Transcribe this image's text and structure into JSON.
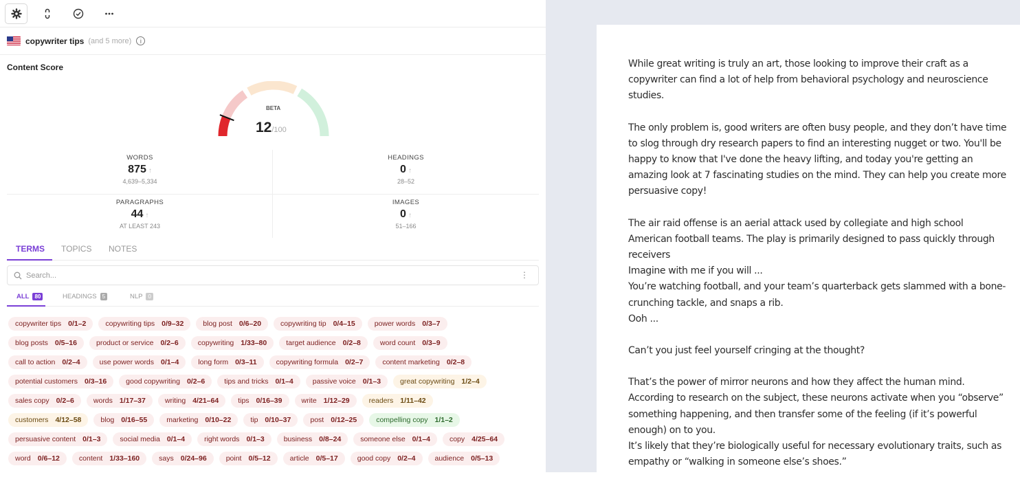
{
  "toolbar": {
    "icons": [
      "gear-icon",
      "link-icon",
      "check-circle-icon",
      "more-icon"
    ]
  },
  "keyword": {
    "main": "copywriter tips",
    "more": "(and 5 more)",
    "info_icon": "i"
  },
  "content_score": {
    "title": "Content Score",
    "beta": "BETA",
    "score": "12",
    "max": "/100",
    "level": 0.12
  },
  "stats": {
    "words": {
      "label": "WORDS",
      "value": "875",
      "range": "4,639–5,334"
    },
    "headings": {
      "label": "HEADINGS",
      "value": "0",
      "range": "28–52"
    },
    "paragraphs": {
      "label": "PARAGRAPHS",
      "value": "44",
      "range": "AT LEAST 243"
    },
    "images": {
      "label": "IMAGES",
      "value": "0",
      "range": "51–166"
    },
    "arrow": "↑"
  },
  "tabs": {
    "terms": "TERMS",
    "topics": "TOPICS",
    "notes": "NOTES"
  },
  "search": {
    "placeholder": "Search...",
    "menu": "⋮"
  },
  "filters": {
    "all": "ALL",
    "all_count": "80",
    "headings": "HEADINGS",
    "headings_count": "5",
    "nlp": "NLP",
    "nlp_count": "0"
  },
  "terms": [
    [
      {
        "t": "copywriter tips",
        "c": "0/1–2",
        "s": "red"
      },
      {
        "t": "copywriting tips",
        "c": "0/9–32",
        "s": "red"
      },
      {
        "t": "blog post",
        "c": "0/6–20",
        "s": "red"
      },
      {
        "t": "copywriting tip",
        "c": "0/4–15",
        "s": "red"
      },
      {
        "t": "power words",
        "c": "0/3–7",
        "s": "red"
      }
    ],
    [
      {
        "t": "blog posts",
        "c": "0/5–16",
        "s": "red"
      },
      {
        "t": "product or service",
        "c": "0/2–6",
        "s": "red"
      },
      {
        "t": "copywriting",
        "c": "1/33–80",
        "s": "red"
      },
      {
        "t": "target audience",
        "c": "0/2–8",
        "s": "red"
      },
      {
        "t": "word count",
        "c": "0/3–9",
        "s": "red"
      }
    ],
    [
      {
        "t": "call to action",
        "c": "0/2–4",
        "s": "red"
      },
      {
        "t": "use power words",
        "c": "0/1–4",
        "s": "red"
      },
      {
        "t": "long form",
        "c": "0/3–11",
        "s": "red"
      },
      {
        "t": "copywriting formula",
        "c": "0/2–7",
        "s": "red"
      },
      {
        "t": "content marketing",
        "c": "0/2–8",
        "s": "red"
      }
    ],
    [
      {
        "t": "potential customers",
        "c": "0/3–16",
        "s": "red"
      },
      {
        "t": "good copywriting",
        "c": "0/2–6",
        "s": "red"
      },
      {
        "t": "tips and tricks",
        "c": "0/1–4",
        "s": "red"
      },
      {
        "t": "passive voice",
        "c": "0/1–3",
        "s": "red"
      },
      {
        "t": "great copywriting",
        "c": "1/2–4",
        "s": "yellow"
      }
    ],
    [
      {
        "t": "sales copy",
        "c": "0/2–6",
        "s": "red"
      },
      {
        "t": "words",
        "c": "1/17–37",
        "s": "red"
      },
      {
        "t": "writing",
        "c": "4/21–64",
        "s": "red"
      },
      {
        "t": "tips",
        "c": "0/16–39",
        "s": "red"
      },
      {
        "t": "write",
        "c": "1/12–29",
        "s": "red"
      },
      {
        "t": "readers",
        "c": "1/11–42",
        "s": "yellow"
      }
    ],
    [
      {
        "t": "customers",
        "c": "4/12–58",
        "s": "yellow"
      },
      {
        "t": "blog",
        "c": "0/16–55",
        "s": "red"
      },
      {
        "t": "marketing",
        "c": "0/10–22",
        "s": "red"
      },
      {
        "t": "tip",
        "c": "0/10–37",
        "s": "red"
      },
      {
        "t": "post",
        "c": "0/12–25",
        "s": "red"
      },
      {
        "t": "compelling copy",
        "c": "1/1–2",
        "s": "green"
      }
    ],
    [
      {
        "t": "persuasive content",
        "c": "0/1–3",
        "s": "red"
      },
      {
        "t": "social media",
        "c": "0/1–4",
        "s": "red"
      },
      {
        "t": "right words",
        "c": "0/1–3",
        "s": "red"
      },
      {
        "t": "business",
        "c": "0/8–24",
        "s": "red"
      },
      {
        "t": "someone else",
        "c": "0/1–4",
        "s": "red"
      },
      {
        "t": "copy",
        "c": "4/25–64",
        "s": "red"
      }
    ],
    [
      {
        "t": "word",
        "c": "0/6–12",
        "s": "red"
      },
      {
        "t": "content",
        "c": "1/33–160",
        "s": "red"
      },
      {
        "t": "says",
        "c": "0/24–96",
        "s": "red"
      },
      {
        "t": "point",
        "c": "0/5–12",
        "s": "red"
      },
      {
        "t": "article",
        "c": "0/5–17",
        "s": "red"
      },
      {
        "t": "good copy",
        "c": "0/2–4",
        "s": "red"
      },
      {
        "t": "audience",
        "c": "0/5–13",
        "s": "red"
      }
    ]
  ],
  "document": {
    "paragraphs": [
      [
        "While great writing is truly an art, those looking to improve their craft as a copywriter can find a lot of help from behavioral psychology and neuroscience studies."
      ],
      [
        "The only problem is, good writers are often busy people, and they don’t have time to slog through dry research papers to find an interesting nugget or two. You'll be happy to know that I've done the heavy lifting, and today you're getting an amazing look at 7 fascinating studies on the mind. They can help you create more persuasive copy!"
      ],
      [
        "The air raid offense is an aerial attack used by collegiate and high school American football teams. The play is primarily designed to pass quickly through receivers",
        "Imagine with me if you will ...",
        "You’re watching football, and your team’s quarterback gets slammed with a bone-crunching tackle, and snaps a rib.",
        "Ooh ..."
      ],
      [
        "Can’t you just feel yourself cringing at the thought?"
      ],
      [
        "That’s the power of mirror neurons and how they affect the human mind. According to research on the subject, these neurons activate when you “observe” something happening, and then transfer some of the feeling (if it’s powerful enough) on to you.",
        "It’s likely that they’re biologically useful for necessary evolutionary traits, such as empathy or “walking in someone else’s shoes.”"
      ]
    ]
  }
}
